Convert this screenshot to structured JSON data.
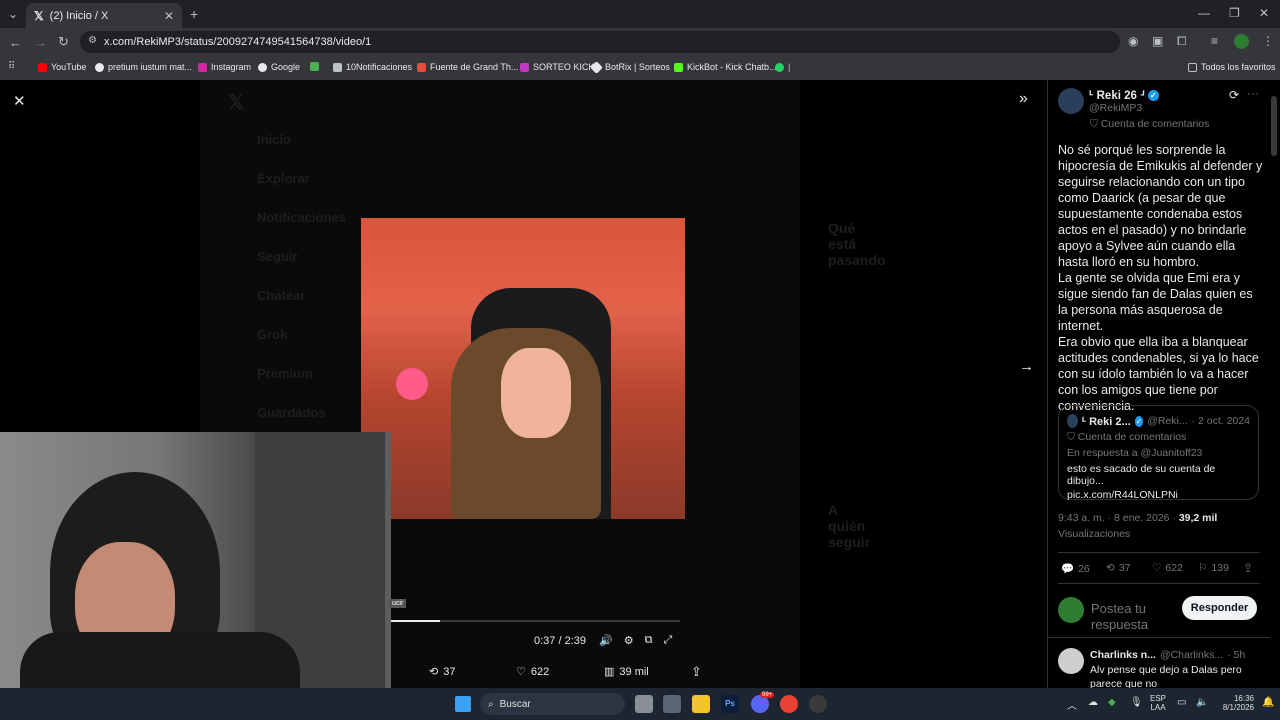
{
  "browser": {
    "tab_title": "(2) Inicio / X",
    "url": "x.com/RekiMP3/status/2009274749541564738/video/1",
    "bookmarks": [
      "YouTube",
      "pretium iustum mat...",
      "Instagram",
      "Google",
      "10Notificaciones",
      "Fuente de Grand Th...",
      "SORTEO KICK",
      "BotRix | Sorteos",
      "KickBot - Kick Chatb..."
    ],
    "all_favorites": "Todos los favoritos"
  },
  "background_nav": [
    "Inicio",
    "Explorar",
    "Notificaciones",
    "Seguir",
    "Chatear",
    "Grok",
    "Premium",
    "Guardados"
  ],
  "background_right": {
    "trending_title": "Qué está pasando",
    "who_to_follow": "A quién seguir"
  },
  "video": {
    "time": "0:37 / 2:39",
    "progress_fraction": 0.17,
    "overlay_label": "ucir",
    "stats": {
      "retweets": "37",
      "likes": "622",
      "views": "39 mil"
    }
  },
  "tweet": {
    "display_name": "ᒻ Reki 26 ᒽ",
    "handle": "@RekiMP3",
    "label": "Cuenta de comentarios",
    "text": "No sé porqué les sorprende la hipocresía de Emikukis al defender y seguirse relacionando con un tipo como Daarick (a pesar de que supuestamente condenaba estos actos en el pasado) y no brindarle apoyo a Sylvee aún cuando ella hasta lloró en su hombro.\nLa gente se olvida que Emi era y sigue siendo fan de Dalas quien es la persona más asquerosa de internet.\nEra obvio que ella iba a blanquear actitudes condenables, si ya lo hace con su ídolo también lo va a hacer con los amigos que tiene por conveniencia.",
    "quote": {
      "display_name": "ᒻ Reki 2...",
      "handle": "@Reki...",
      "date": "· 2 oct. 2024",
      "label": "Cuenta de comentarios",
      "reply_to": "En respuesta a @Juanitoff23",
      "text": "esto es sacado de su cuenta de dibujo...",
      "link": "pic.x.com/R44LONLPNi"
    },
    "time": "9:43 a. m. · 8 ene. 2026 ·",
    "views_count": "39,2 mil",
    "views_label": "Visualizaciones",
    "actions": {
      "replies": "26",
      "retweets": "37",
      "likes": "622",
      "bookmarks": "139"
    },
    "reply_placeholder": "Postea tu respuesta",
    "reply_button": "Responder"
  },
  "reply": {
    "display_name": "Charlinks n...",
    "handle": "@Charlinks...",
    "age": "· 5h",
    "text": "Alv pense que dejo a Dalas pero parece que no"
  },
  "taskbar": {
    "search": "Buscar",
    "lang": "ESP",
    "lang2": "LAA",
    "time": "16:36",
    "date": "8/1/2026",
    "badge": "99+"
  }
}
